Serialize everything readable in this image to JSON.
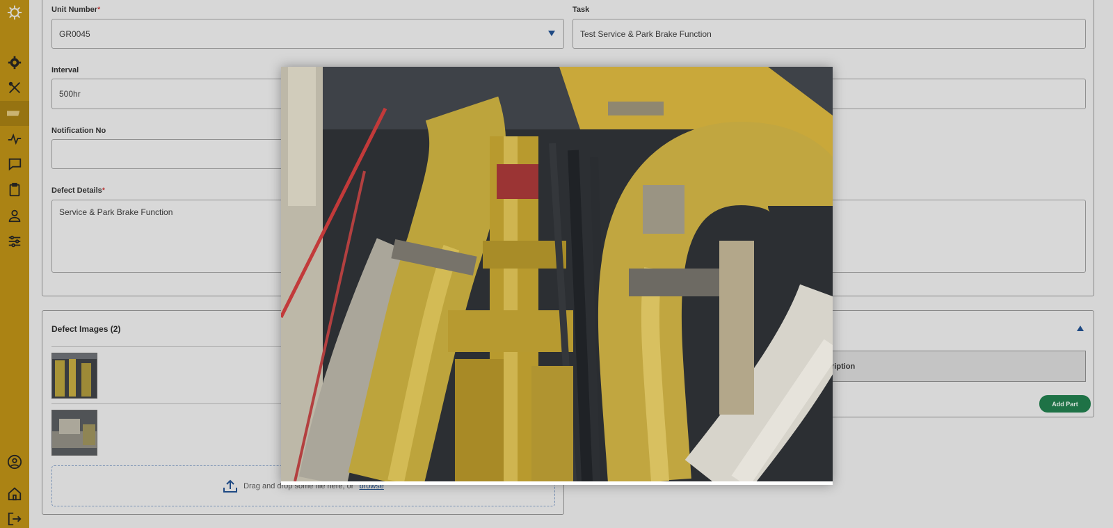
{
  "form": {
    "unit_number_label": "Unit Number",
    "unit_number_value": "GR0045",
    "task_label": "Task",
    "task_value": "Test Service & Park Brake Function",
    "interval_label": "Interval",
    "interval_value": "500hr",
    "notification_label": "Notification No",
    "notification_value": "",
    "defect_details_label": "Defect Details",
    "defect_details_value": "Service & Park Brake Function",
    "required_mark": "*"
  },
  "images_section": {
    "title": "Defect Images (2)",
    "dropzone_text": "Drag and drop some file here, or",
    "browse_label": "browse"
  },
  "parts_section": {
    "description_header": "Description",
    "add_part_label": "Add Part"
  },
  "sidebar": {
    "items": [
      "logo-icon",
      "gear-icon",
      "tools-icon",
      "truck-icon",
      "activity-icon",
      "chat-icon",
      "clipboard-icon",
      "user-icon",
      "sliders-icon",
      "account-icon",
      "home-icon",
      "logout-icon"
    ]
  },
  "colors": {
    "sidebar": "#b88d14",
    "accent": "#1f4e8c",
    "add_part": "#1f7a4a"
  }
}
